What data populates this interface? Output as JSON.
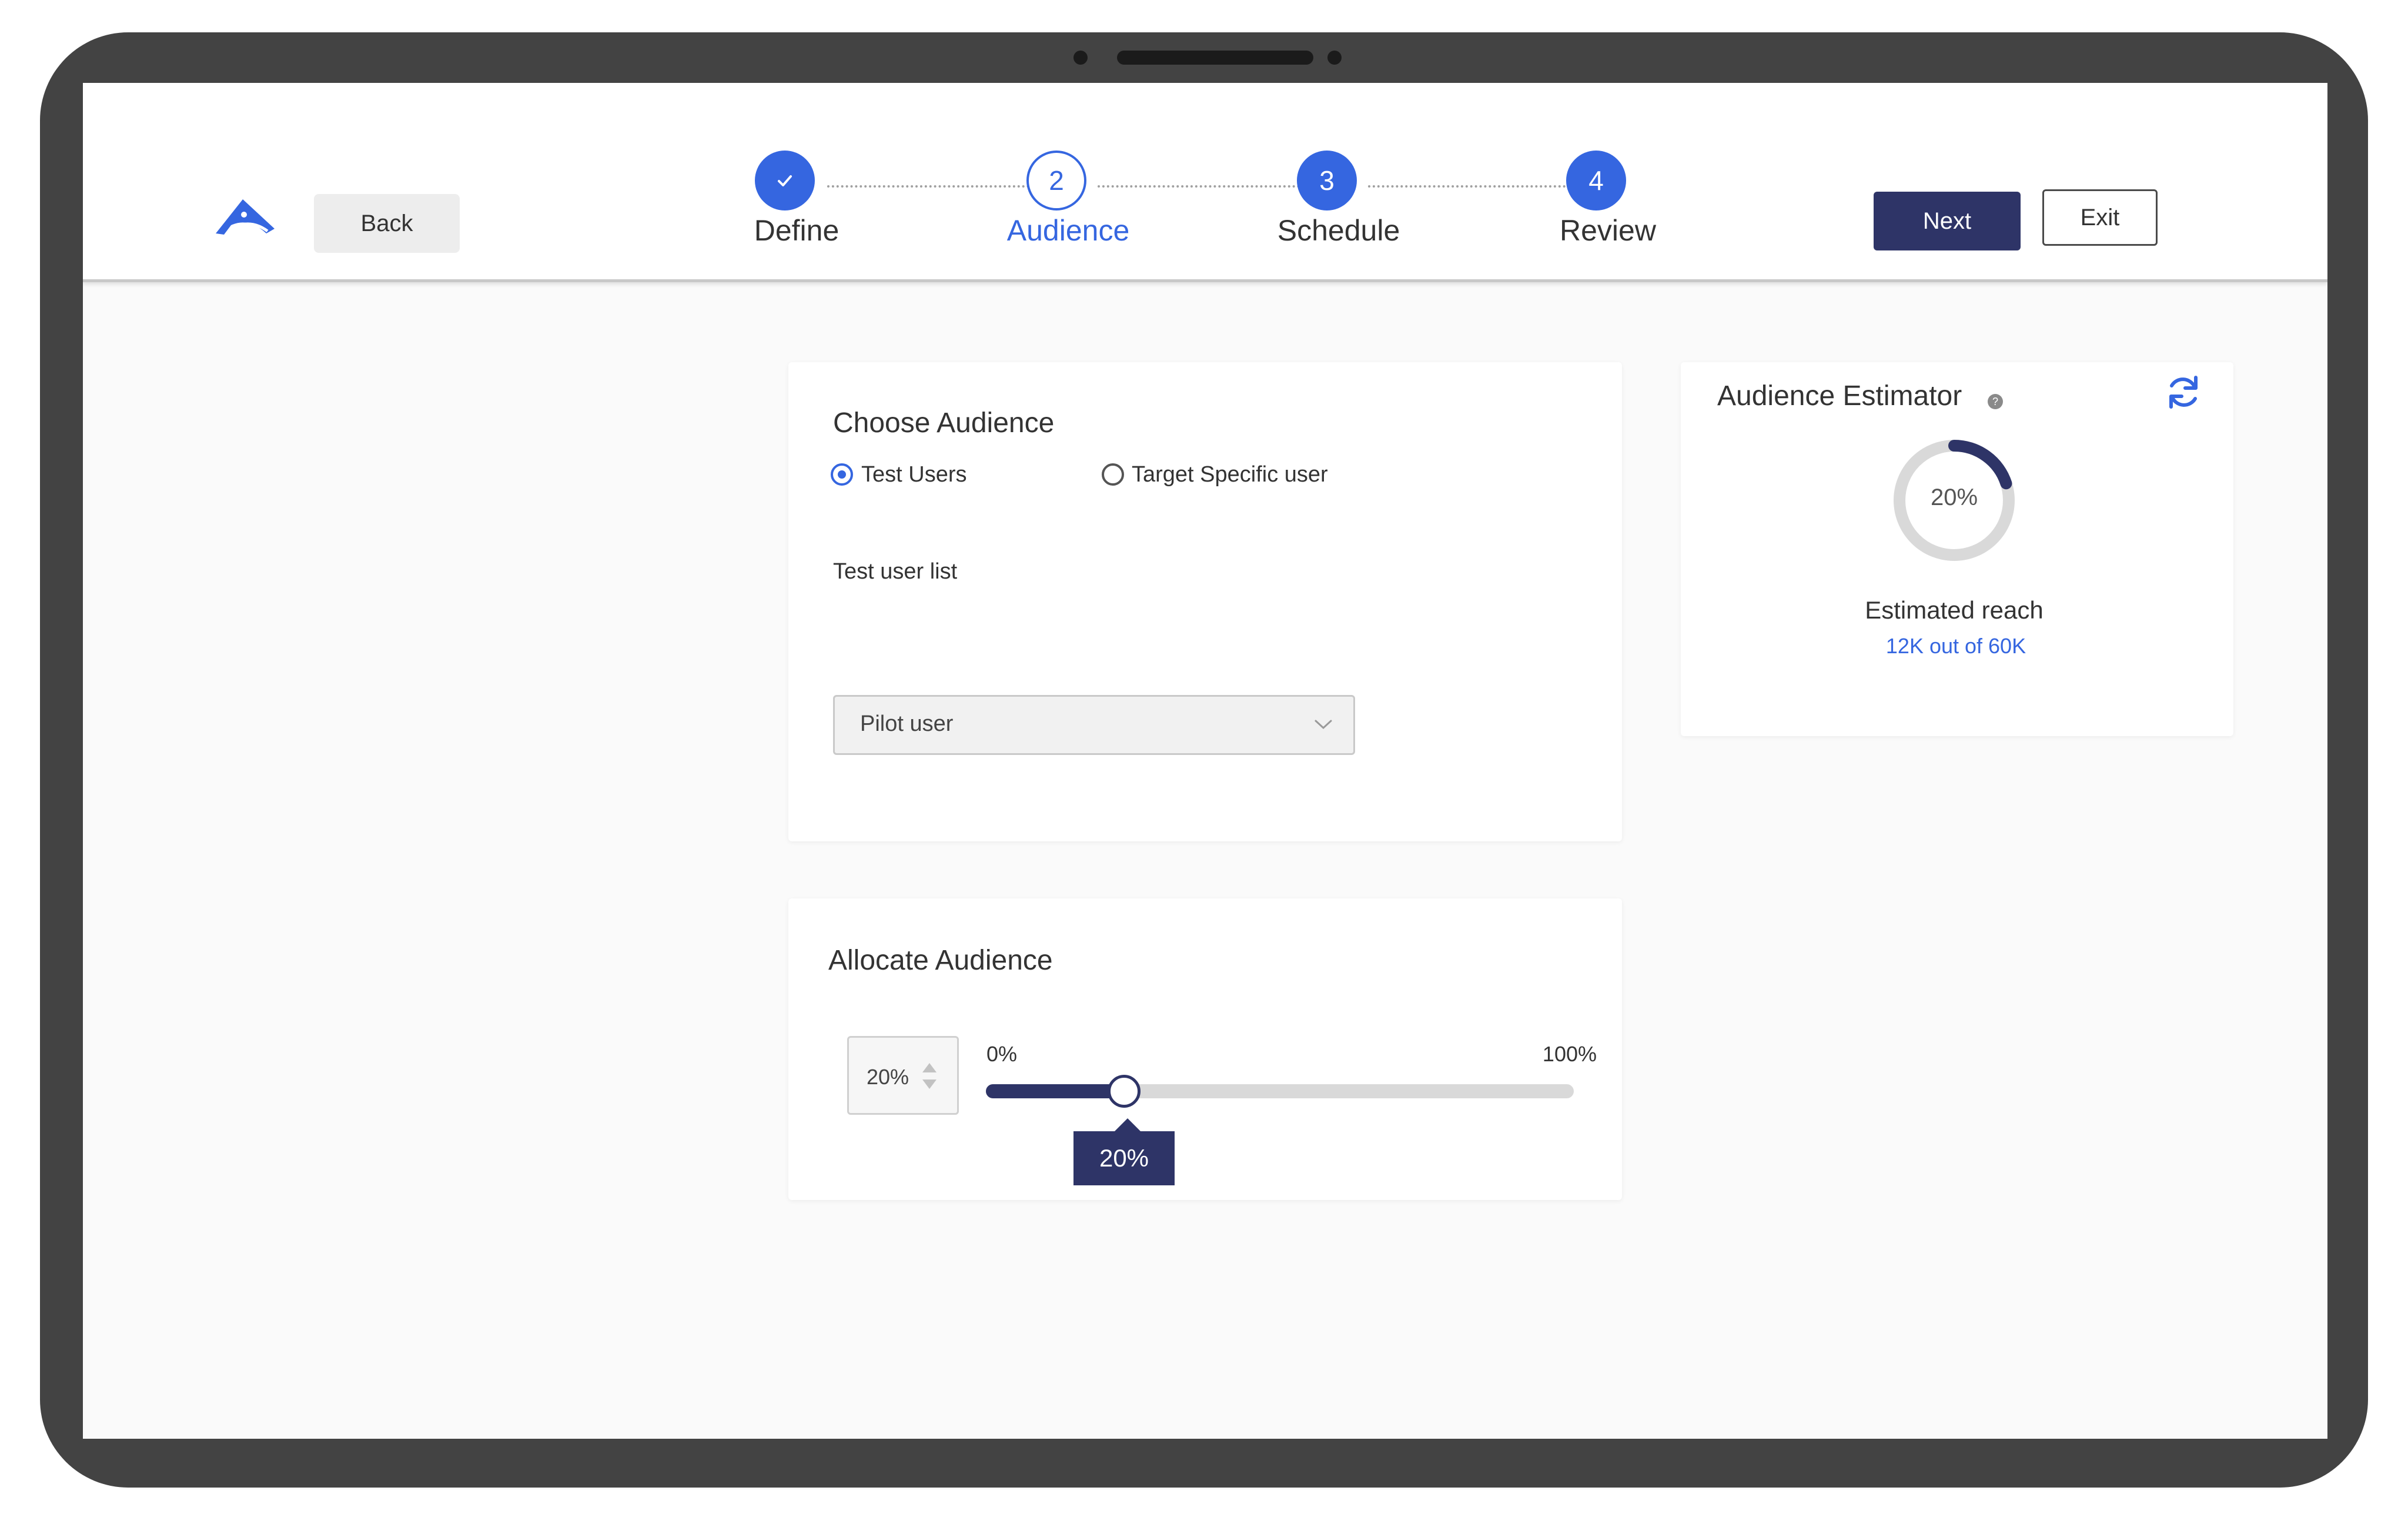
{
  "header": {
    "back_label": "Back",
    "next_label": "Next",
    "exit_label": "Exit"
  },
  "stepper": {
    "steps": [
      {
        "number": "",
        "label": "Define",
        "state": "completed"
      },
      {
        "number": "2",
        "label": "Audience",
        "state": "current"
      },
      {
        "number": "3",
        "label": "Schedule",
        "state": "upcoming"
      },
      {
        "number": "4",
        "label": "Review",
        "state": "upcoming"
      }
    ]
  },
  "choose_audience": {
    "title": "Choose Audience",
    "options": [
      {
        "label": "Test Users",
        "selected": true
      },
      {
        "label": "Target Specific user",
        "selected": false
      }
    ],
    "list_label": "Test user list",
    "list_value": "Pilot user"
  },
  "allocate_audience": {
    "title": "Allocate Audience",
    "input_value": "20%",
    "min_label": "0%",
    "max_label": "100%",
    "tooltip": "20%",
    "value_percent": 20
  },
  "estimator": {
    "title": "Audience Estimator",
    "donut_label": "20%",
    "donut_percent": 20,
    "reach_label": "Estimated reach",
    "reach_value": "12K out of 60K"
  },
  "colors": {
    "primary": "#3566e0",
    "navy": "#2e3467",
    "frame": "#434343",
    "track": "#d9d9d9"
  },
  "icons": [
    "logo-icon",
    "check-icon",
    "radio-icon",
    "chevron-down-icon",
    "sort-arrows-icon",
    "help-icon",
    "refresh-icon"
  ]
}
